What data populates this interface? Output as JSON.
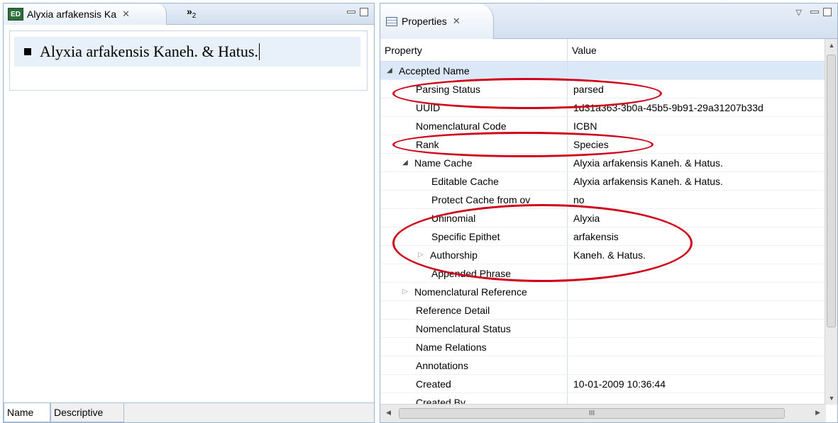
{
  "left_editor": {
    "tab_title": "Alyxia arfakensis Ka",
    "editor_icon_text": "ED",
    "close_glyph": "✕",
    "overflow_glyph": "»",
    "overflow_count": "2",
    "name_text": "Alyxia arfakensis Kaneh. & Hatus.",
    "bottom_tabs": [
      "Name",
      "Descriptive"
    ]
  },
  "properties": {
    "tab_title": "Properties",
    "close_glyph": "✕",
    "columns": {
      "property": "Property",
      "value": "Value"
    },
    "rows": [
      {
        "property": "Accepted Name",
        "value": "",
        "indent": 0,
        "expander": "open",
        "category": true
      },
      {
        "property": "Parsing Status",
        "value": "parsed",
        "indent": 2
      },
      {
        "property": "UUID",
        "value": "1d31a363-3b0a-45b5-9b91-29a31207b33d",
        "indent": 2
      },
      {
        "property": "Nomenclatural Code",
        "value": "ICBN",
        "indent": 2
      },
      {
        "property": "Rank",
        "value": "Species",
        "indent": 2
      },
      {
        "property": "Name Cache",
        "value": "Alyxia arfakensis Kaneh. & Hatus.",
        "indent": 1,
        "expander": "open"
      },
      {
        "property": "Editable Cache",
        "value": "Alyxia arfakensis Kaneh. & Hatus.",
        "indent": 3
      },
      {
        "property": "Protect Cache from ov",
        "value": "no",
        "indent": 3
      },
      {
        "property": "Uninomial",
        "value": "Alyxia",
        "indent": 3
      },
      {
        "property": "Specific Epithet",
        "value": "arfakensis",
        "indent": 3
      },
      {
        "property": "Authorship",
        "value": "Kaneh. & Hatus.",
        "indent": 2,
        "expander": "closed"
      },
      {
        "property": "Appended Phrase",
        "value": "",
        "indent": 3
      },
      {
        "property": "Nomenclatural Reference",
        "value": "",
        "indent": 1,
        "expander": "closed"
      },
      {
        "property": "Reference Detail",
        "value": "",
        "indent": 2
      },
      {
        "property": "Nomenclatural Status",
        "value": "",
        "indent": 2
      },
      {
        "property": "Name Relations",
        "value": "",
        "indent": 2
      },
      {
        "property": "Annotations",
        "value": "",
        "indent": 2
      },
      {
        "property": "Created",
        "value": "10-01-2009 10:36:44",
        "indent": 2
      },
      {
        "property": "Created By",
        "value": "",
        "indent": 2
      }
    ],
    "hscroll_grip": "III"
  },
  "colors": {
    "annotation_red": "#d0021b",
    "category_row": "#dbe8f7",
    "tab_gradient_top": "#e8eff8"
  }
}
